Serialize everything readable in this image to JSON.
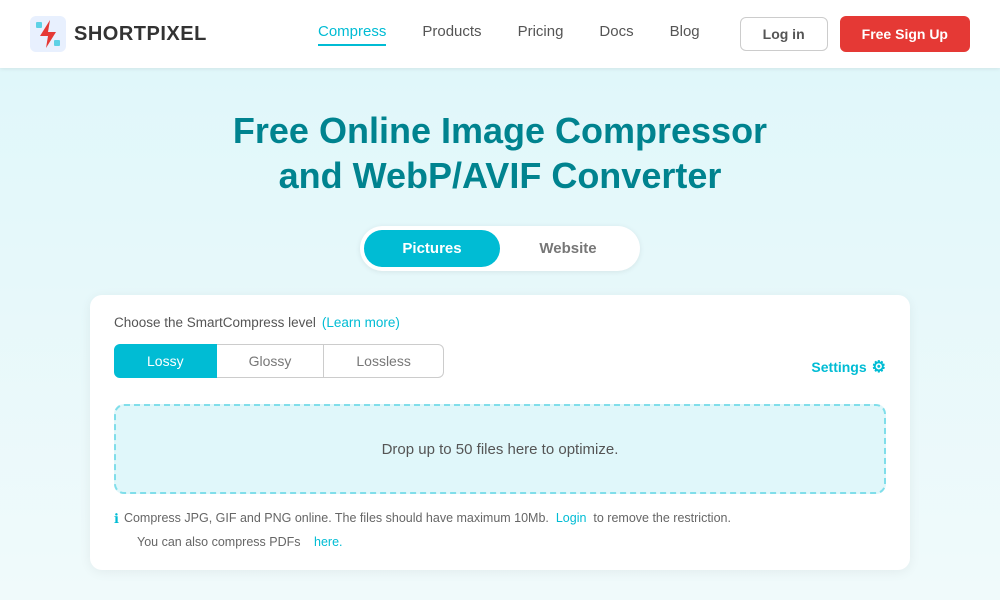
{
  "navbar": {
    "logo_short": "SHORT",
    "logo_pixel": "PIXEL",
    "links": [
      {
        "label": "Compress",
        "active": true
      },
      {
        "label": "Products",
        "active": false
      },
      {
        "label": "Pricing",
        "active": false
      },
      {
        "label": "Docs",
        "active": false
      },
      {
        "label": "Blog",
        "active": false
      }
    ],
    "login_label": "Log in",
    "signup_label": "Free Sign Up"
  },
  "hero": {
    "title_line1": "Free Online Image Compressor",
    "title_line2": "and WebP/AVIF Converter"
  },
  "tabs": [
    {
      "label": "Pictures",
      "active": true
    },
    {
      "label": "Website",
      "active": false
    }
  ],
  "compress": {
    "level_label": "Choose the SmartCompress level",
    "learn_more_label": "(Learn more)",
    "levels": [
      {
        "label": "Lossy",
        "active": true
      },
      {
        "label": "Glossy",
        "active": false
      },
      {
        "label": "Lossless",
        "active": false
      }
    ],
    "settings_label": "Settings",
    "drop_zone_text": "Drop up to 50 files here to optimize.",
    "info_line1": "Compress JPG, GIF and PNG online. The files should have maximum 10Mb.",
    "info_login_link": "Login",
    "info_login_suffix": "to remove the restriction.",
    "info_line2_prefix": "You can also compress PDFs",
    "info_here_link": "here."
  }
}
